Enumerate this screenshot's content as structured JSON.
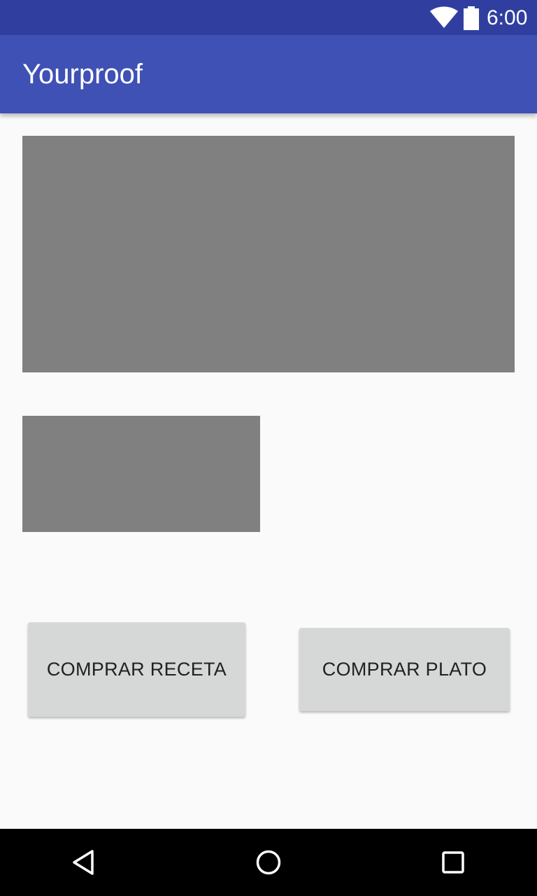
{
  "status_bar": {
    "time": "6:00",
    "icons": [
      "wifi-icon",
      "battery-icon"
    ],
    "color": "#303F9F"
  },
  "app_bar": {
    "title": "Yourproof",
    "color": "#3F51B5"
  },
  "content": {
    "placeholder_color": "#808080",
    "buttons": {
      "comprar_receta": "COMPRAR RECETA",
      "comprar_plato": "COMPRAR PLATO"
    }
  },
  "nav_bar": {
    "icons": [
      "back-icon",
      "home-icon",
      "recents-icon"
    ]
  }
}
